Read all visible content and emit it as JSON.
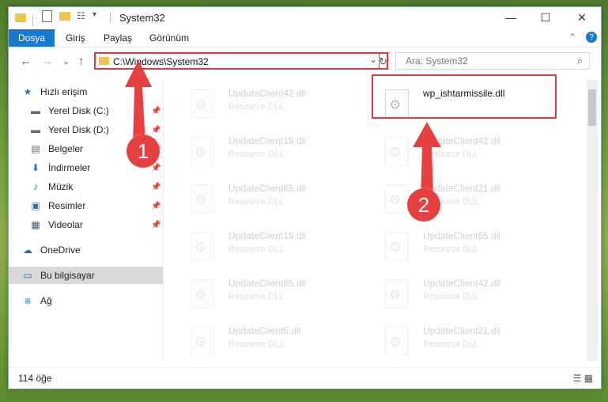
{
  "window": {
    "title": "System32",
    "controls": {
      "minimize": "—",
      "maximize": "☐",
      "close": "✕"
    },
    "help_icon": "?",
    "collapse_icon": "⌃"
  },
  "ribbon": {
    "file_tab": "Dosya",
    "tabs": [
      "Giriş",
      "Paylaş",
      "Görünüm"
    ]
  },
  "nav": {
    "address": "C:\\Windows\\System32",
    "search_placeholder": "Ara: System32",
    "refresh_icon": "↻",
    "back_icon": "←",
    "forward_icon": "→",
    "up_icon": "↑",
    "recent_icon": "⌄",
    "dropdown_icon": "⌄",
    "search_icon": "⌕"
  },
  "sidebar": {
    "items": [
      {
        "label": "Hızlı erişim",
        "icon": "★",
        "pinned": false
      },
      {
        "label": "Yerel Disk (C:)",
        "icon": "▬",
        "pinned": true
      },
      {
        "label": "Yerel Disk (D:)",
        "icon": "▬",
        "pinned": true
      },
      {
        "label": "Belgeler",
        "icon": "▤",
        "pinned": true
      },
      {
        "label": "İndirmeler",
        "icon": "⬇",
        "pinned": true
      },
      {
        "label": "Müzik",
        "icon": "♪",
        "pinned": true
      },
      {
        "label": "Resimler",
        "icon": "▣",
        "pinned": true
      },
      {
        "label": "Videolar",
        "icon": "▦",
        "pinned": true
      },
      {
        "label": "OneDrive",
        "icon": "☁",
        "pinned": false
      },
      {
        "label": "Bu bilgisayar",
        "icon": "▭",
        "pinned": false
      },
      {
        "label": "Ağ",
        "icon": "⎈",
        "pinned": false
      }
    ]
  },
  "files": [
    {
      "name": "UpdateClient42.dll",
      "type": "Resource DLL"
    },
    {
      "name": "wp_ishtarmissile.dll",
      "type": ""
    },
    {
      "name": "UpdateClient19.dll",
      "type": "Resource DLL"
    },
    {
      "name": "UpdateClient42.dll",
      "type": "Resource DLL"
    },
    {
      "name": "UpdateClient65.dll",
      "type": "Resource DLL"
    },
    {
      "name": "UpdateClient21.dll",
      "type": "Resource DLL"
    },
    {
      "name": "UpdateClient19.dll",
      "type": "Resource DLL"
    },
    {
      "name": "UpdateClient65.dll",
      "type": "Resource DLL"
    },
    {
      "name": "UpdateClient65.dll",
      "type": "Resource DLL"
    },
    {
      "name": "UpdateClient42.dll",
      "type": "Resource DLL"
    },
    {
      "name": "UpdateClient5.dll",
      "type": "Resource DLL"
    },
    {
      "name": "UpdateClient21.dll",
      "type": "Resource DLL"
    }
  ],
  "status": {
    "count": "114 öğe"
  },
  "annotations": {
    "step1": "1",
    "step2": "2",
    "highlight_color": "#e03a3a"
  }
}
